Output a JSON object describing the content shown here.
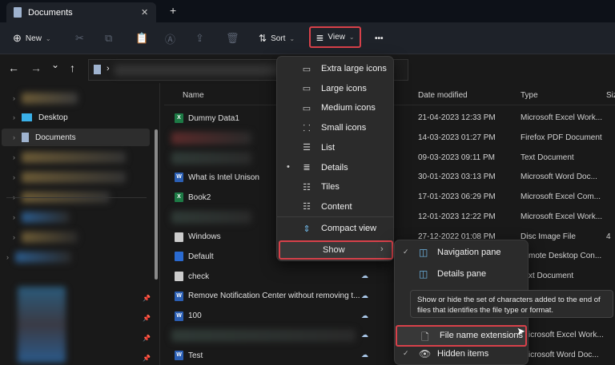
{
  "window": {
    "tab_title": "Documents",
    "close": "✕",
    "new_tab": "+"
  },
  "toolbar": {
    "new_label": "New",
    "sort_label": "Sort",
    "view_label": "View",
    "more": "•••"
  },
  "nav": {
    "back": "←",
    "forward": "→",
    "recent": "⌄",
    "up": "↑",
    "sep": "›"
  },
  "sidebar": {
    "items": [
      {
        "label": "Desktop"
      },
      {
        "label": "Documents"
      }
    ]
  },
  "columns": {
    "name": "Name",
    "date": "Date modified",
    "type": "Type",
    "size": "Siz"
  },
  "files": [
    {
      "name": "Dummy Data1",
      "date": "21-04-2023 12:33 PM",
      "type": "Microsoft Excel Work...",
      "icon": "xl"
    },
    {
      "name": "",
      "date": "14-03-2023 01:27 PM",
      "type": "Firefox PDF Document",
      "icon": "blur"
    },
    {
      "name": "",
      "date": "09-03-2023 09:11 PM",
      "type": "Text Document",
      "icon": "blur"
    },
    {
      "name": "What is Intel Unison",
      "date": "30-01-2023 03:13 PM",
      "type": "Microsoft Word Doc...",
      "icon": "wd"
    },
    {
      "name": "Book2",
      "date": "17-01-2023 06:29 PM",
      "type": "Microsoft Excel Com...",
      "icon": "xl"
    },
    {
      "name": "",
      "date": "12-01-2023 12:22 PM",
      "type": "Microsoft Excel Work...",
      "icon": "blur"
    },
    {
      "name": "Windows",
      "date": "27-12-2022 01:08 PM",
      "type": "Disc Image File",
      "size": "4",
      "icon": "gen"
    },
    {
      "name": "Default",
      "type": "mote Desktop Con...",
      "icon": "rdp"
    },
    {
      "name": "check",
      "type": "xt Document",
      "icon": "gen"
    },
    {
      "name": "Remove Notification Center without removing t...",
      "icon": "wd"
    },
    {
      "name": "100",
      "icon": "wd"
    },
    {
      "name": "",
      "type": "icrosoft Excel Work...",
      "icon": "blur"
    },
    {
      "name": "Test",
      "type": "icrosoft Word Doc...",
      "icon": "wd"
    }
  ],
  "view_menu": {
    "items": [
      {
        "label": "Extra large icons",
        "icon": "▭"
      },
      {
        "label": "Large icons",
        "icon": "▭"
      },
      {
        "label": "Medium icons",
        "icon": "▭"
      },
      {
        "label": "Small icons",
        "icon": "⸬"
      },
      {
        "label": "List",
        "icon": "☰"
      },
      {
        "label": "Details",
        "icon": "≣",
        "selected": true
      },
      {
        "label": "Tiles",
        "icon": "☷"
      },
      {
        "label": "Content",
        "icon": "☷"
      },
      {
        "label": "Compact view",
        "icon": "⇕"
      }
    ],
    "show_label": "Show",
    "show_arrow": "›",
    "bullet": "•"
  },
  "show_menu": {
    "items": [
      {
        "label": "Navigation pane",
        "checked": true,
        "icon": "◫"
      },
      {
        "label": "Details pane",
        "checked": false,
        "icon": "◫"
      },
      {
        "label": "File name extensions",
        "checked": false,
        "icon": "🗋"
      },
      {
        "label": "Hidden items",
        "checked": true,
        "icon": "👁"
      }
    ],
    "check": "✓"
  },
  "tooltip": "Show or hide the set of characters added to the end of files that identifies the file type or format.",
  "colors": {
    "highlight": "#d8414a",
    "accent": "#6fb7e6"
  }
}
